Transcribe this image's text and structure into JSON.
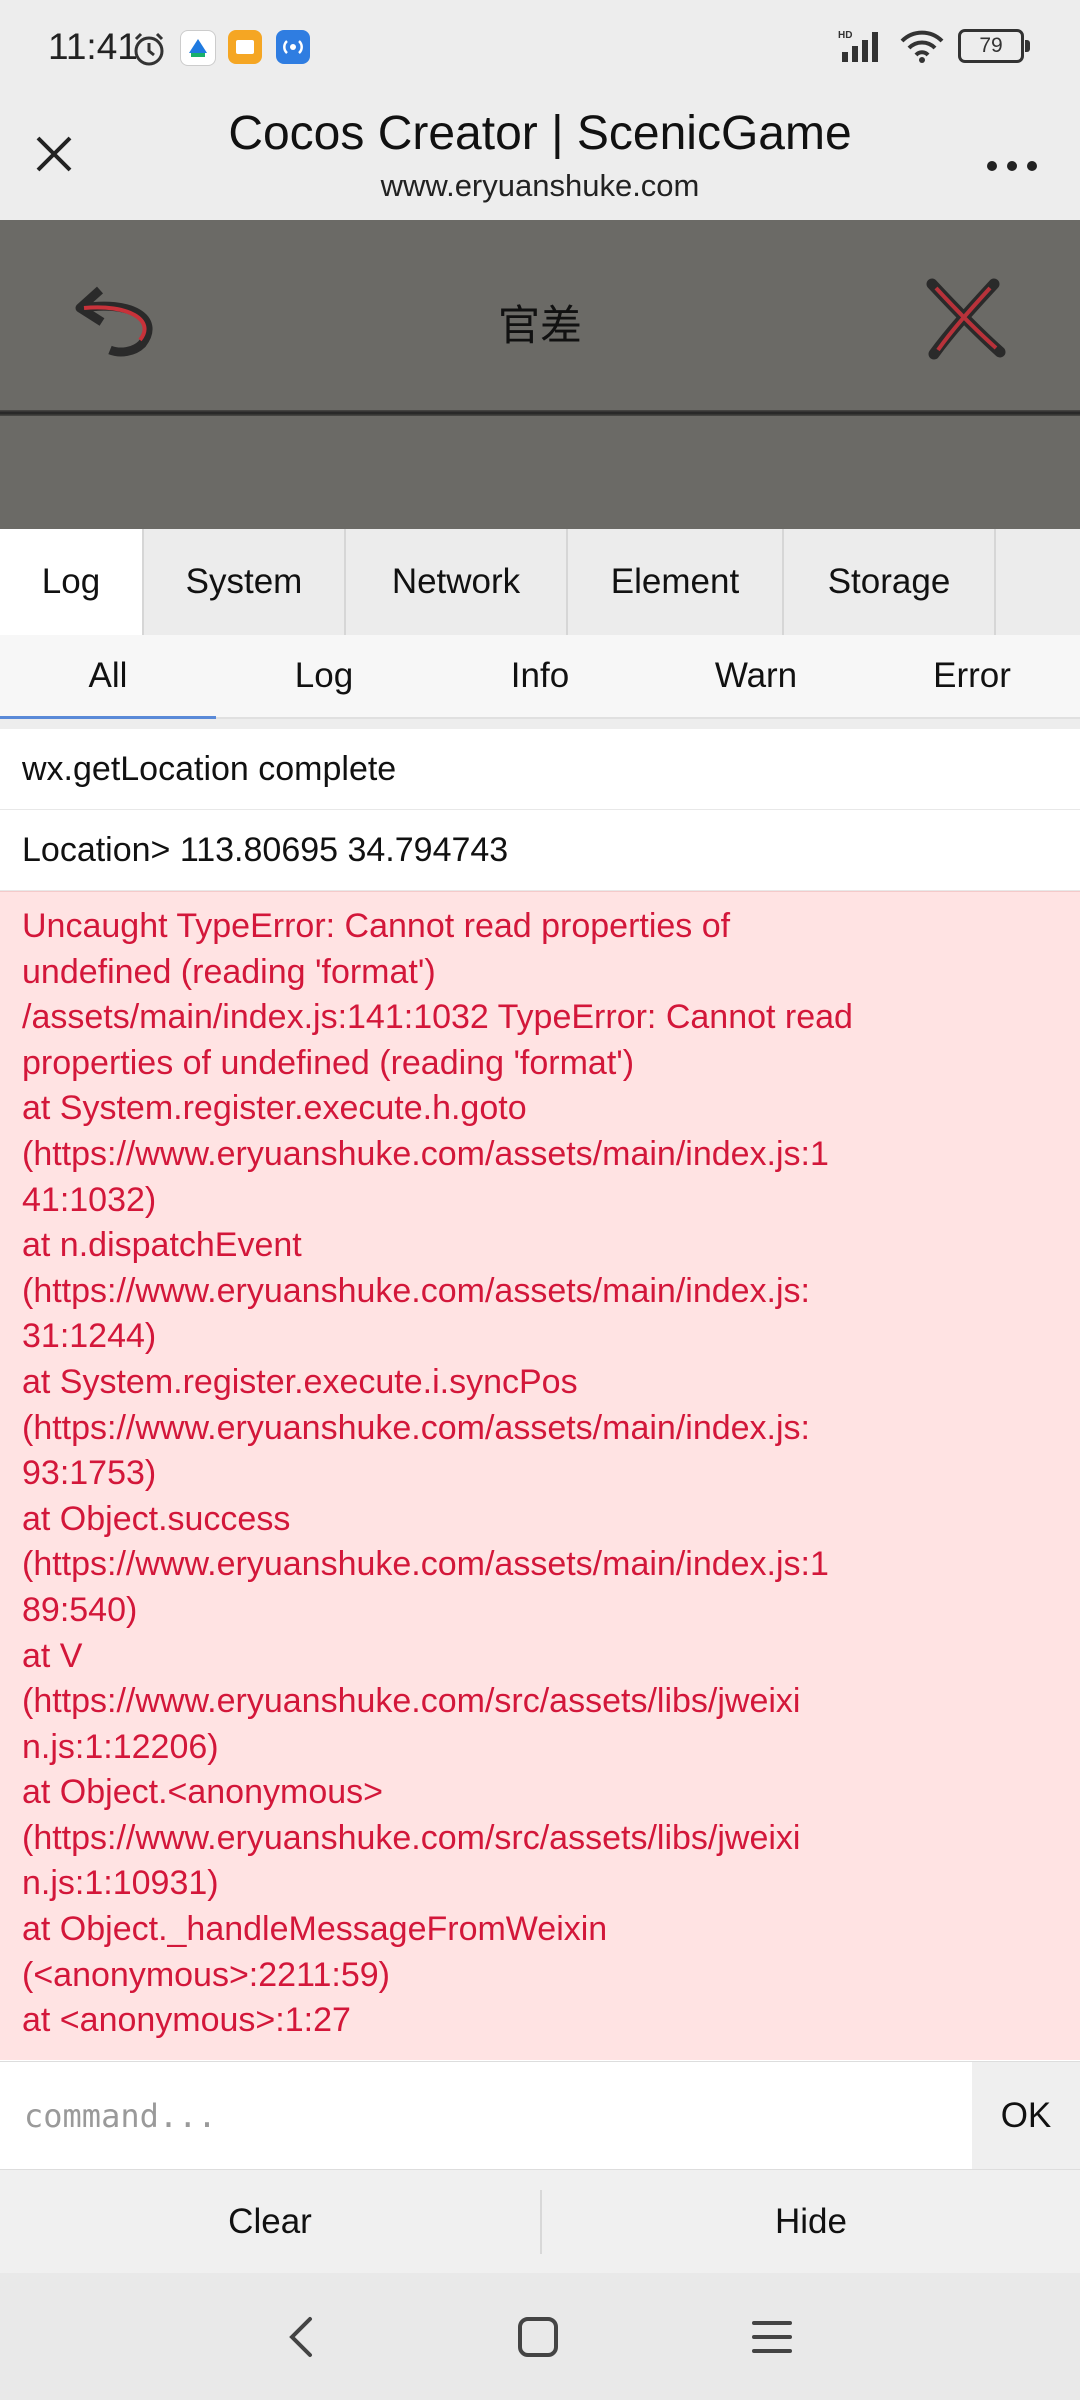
{
  "status_bar": {
    "time": "11:41",
    "battery": "79",
    "icons": [
      "alarm-icon",
      "app-notification-icon",
      "folder-app-icon",
      "radio-app-icon",
      "hd-signal-icon",
      "wifi-icon"
    ]
  },
  "titlebar": {
    "title": "Cocos Creator | ScenicGame",
    "subtitle": "www.eryuanshuke.com"
  },
  "game": {
    "title": "官差"
  },
  "console": {
    "tabs": [
      {
        "label": "Log",
        "active": true
      },
      {
        "label": "System",
        "active": false
      },
      {
        "label": "Network",
        "active": false
      },
      {
        "label": "Element",
        "active": false
      },
      {
        "label": "Storage",
        "active": false
      }
    ],
    "filters": [
      {
        "label": "All",
        "active": true
      },
      {
        "label": "Log",
        "active": false
      },
      {
        "label": "Info",
        "active": false
      },
      {
        "label": "Warn",
        "active": false
      },
      {
        "label": "Error",
        "active": false
      }
    ],
    "logs": [
      "wx.getLocation complete",
      "Location> 113.80695 34.794743"
    ],
    "error_text": "Uncaught TypeError: Cannot read properties of\nundefined (reading 'format')\n/assets/main/index.js:141:1032 TypeError: Cannot read\nproperties of undefined (reading 'format')\nat System.register.execute.h.goto\n(https://www.eryuanshuke.com/assets/main/index.js:1\n41:1032)\nat n.dispatchEvent\n(https://www.eryuanshuke.com/assets/main/index.js:\n31:1244)\nat System.register.execute.i.syncPos\n(https://www.eryuanshuke.com/assets/main/index.js:\n93:1753)\nat Object.success\n(https://www.eryuanshuke.com/assets/main/index.js:1\n89:540)\nat V\n(https://www.eryuanshuke.com/src/assets/libs/jweixi\nn.js:1:12206)\nat Object.<anonymous>\n(https://www.eryuanshuke.com/src/assets/libs/jweixi\nn.js:1:10931)\nat Object._handleMessageFromWeixin\n(<anonymous>:2211:59)\nat <anonymous>:1:27",
    "command_placeholder": "command...",
    "ok_label": "OK",
    "clear_label": "Clear",
    "hide_label": "Hide"
  },
  "colors": {
    "error_bg": "#ffe3e3",
    "error_text": "#d3173a",
    "active_underline": "#5a8ad8",
    "game_bg": "#6b6a66"
  }
}
